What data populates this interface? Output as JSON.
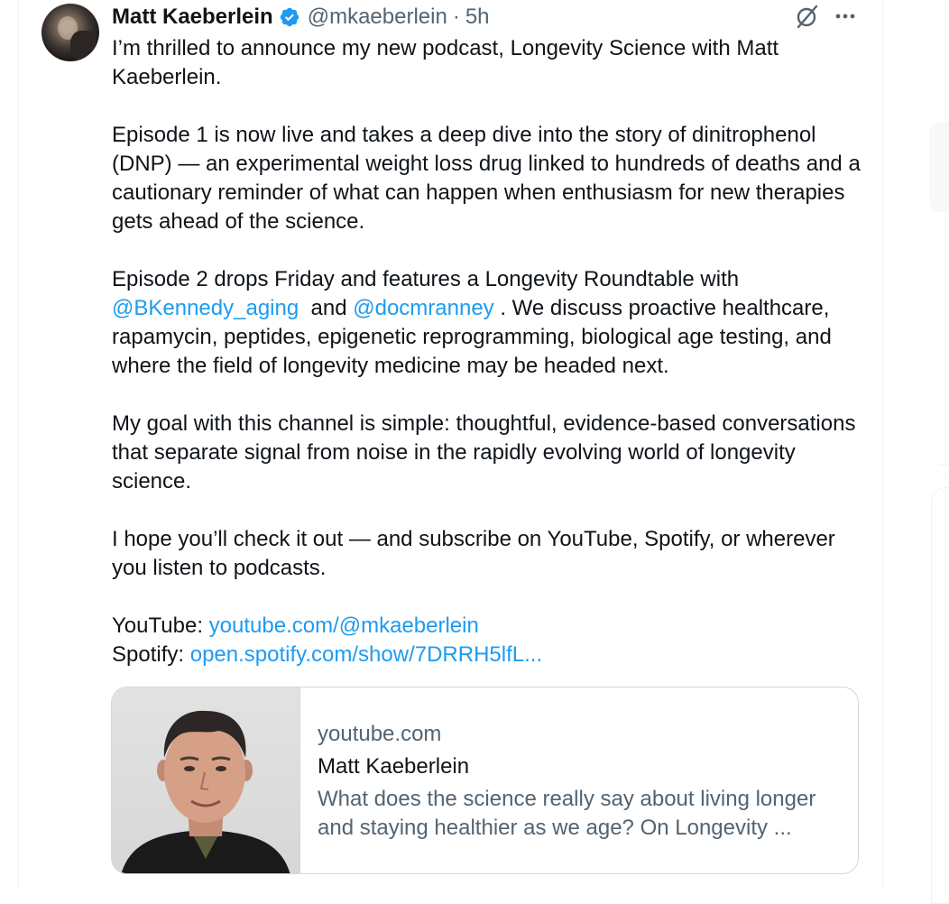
{
  "post": {
    "author": {
      "name": "Matt Kaeberlein",
      "handle": "@mkaeberlein",
      "separator": "·",
      "time": "5h",
      "verified": true
    },
    "icons": {
      "verified": "verified-badge-icon",
      "grok": "grok-icon",
      "more": "more-options-icon"
    },
    "colors": {
      "link": "#1d9bf0",
      "verified": "#1d9bf0",
      "text": "#0f1419",
      "secondary": "#536471"
    },
    "paragraph1": "I’m thrilled to announce my new podcast, Longevity Science with Matt Kaeberlein.",
    "paragraph2": "Episode 1 is now live and takes a deep dive into the story of dinitrophenol (DNP) — an experimental weight loss drug linked to hundreds of deaths and a cautionary reminder of what can happen when enthusiasm for new therapies gets ahead of the science.",
    "paragraph3": {
      "text_before": "Episode 2 drops Friday and features a Longevity Roundtable with ",
      "mention1": "@BKennedy_aging",
      "text_between": "  and ",
      "mention2": "@docmranney",
      "text_after": " . We discuss proactive healthcare, rapamycin, peptides, epigenetic reprogramming, biological age testing, and where the field of longevity medicine may be headed next."
    },
    "paragraph4": "My goal with this channel is simple: thoughtful, evidence-based conversations that separate signal from noise in the rapidly evolving world of longevity science.",
    "paragraph5": "I hope you’ll check it out — and subscribe on YouTube, Spotify, or wherever you listen to podcasts.",
    "youtube": {
      "label": "YouTube: ",
      "link": "youtube.com/@mkaeberlein"
    },
    "spotify": {
      "label": "Spotify: ",
      "link": "open.spotify.com/show/7DRRH5lfL..."
    },
    "card": {
      "domain": "youtube.com",
      "title": "Matt Kaeberlein",
      "description": "What does the science really say about living longer and staying healthier as we age? On Longevity ..."
    }
  }
}
